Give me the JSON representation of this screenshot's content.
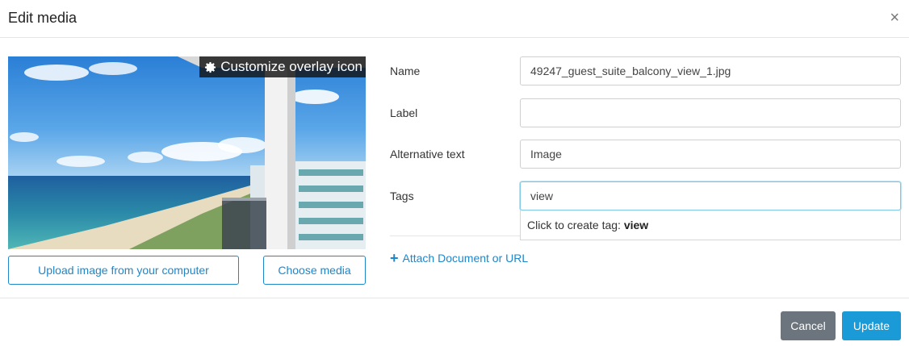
{
  "dialog": {
    "title": "Edit media",
    "close_symbol": "×",
    "close_icon": "close-icon"
  },
  "media": {
    "overlay_label": "Customize overlay icon",
    "overlay_icon": "gear-icon",
    "upload_label": "Upload image from your computer",
    "choose_label": "Choose media"
  },
  "form": {
    "name": {
      "label": "Name",
      "value": "49247_guest_suite_balcony_view_1.jpg"
    },
    "label": {
      "label": "Label",
      "value": ""
    },
    "alt": {
      "label": "Alternative text",
      "value": "Image"
    },
    "tags": {
      "label": "Tags",
      "value": "view"
    },
    "tag_suggestion": {
      "prefix": "Click to create tag: ",
      "tag": "view"
    },
    "attach": {
      "icon": "plus-icon",
      "label": "Attach Document or URL"
    }
  },
  "footer": {
    "cancel_label": "Cancel",
    "update_label": "Update"
  },
  "colors": {
    "primary": "#1a9ad6",
    "link": "#1f86c9",
    "cancel": "#6c757d",
    "focus_border": "#7fc7e6"
  }
}
